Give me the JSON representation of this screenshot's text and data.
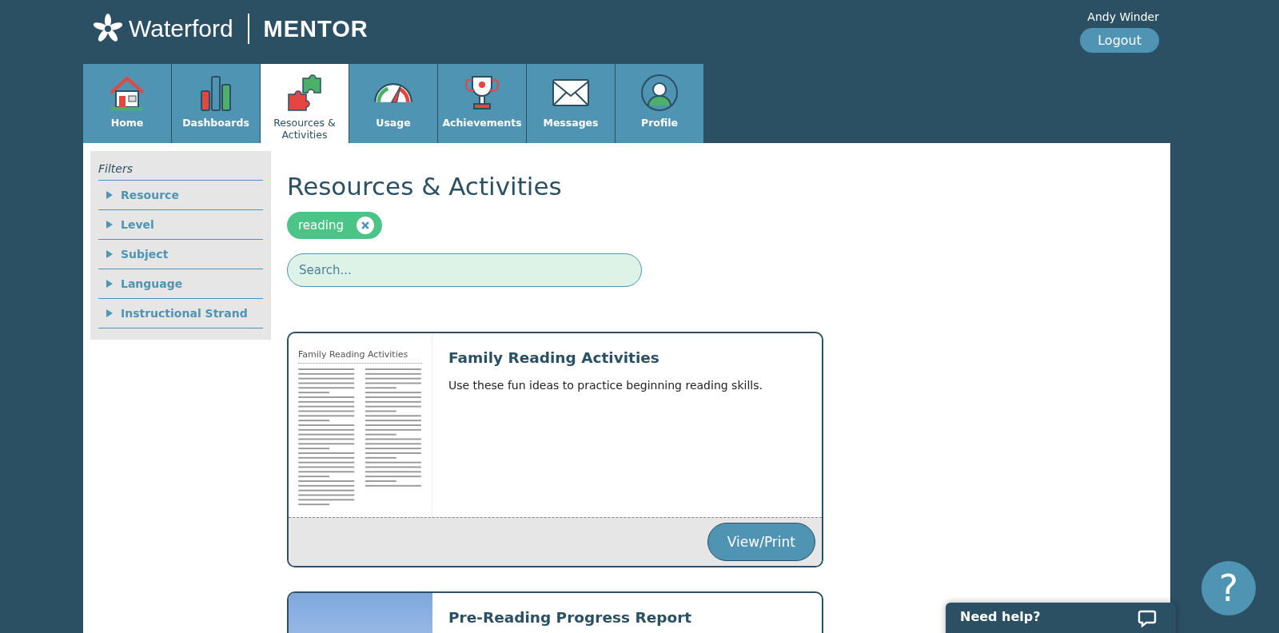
{
  "header": {
    "logo_text": "Waterford",
    "product": "MENTOR",
    "user": "Andy Winder",
    "logout": "Logout"
  },
  "tabs": [
    {
      "label": "Home",
      "kind": "home",
      "selected": false
    },
    {
      "label": "Dashboards",
      "kind": "bars",
      "selected": false
    },
    {
      "label": "Resources & Activities",
      "kind": "puzzle",
      "selected": true
    },
    {
      "label": "Usage",
      "kind": "gauge",
      "selected": false
    },
    {
      "label": "Achievements",
      "kind": "trophy",
      "selected": false
    },
    {
      "label": "Messages",
      "kind": "mail",
      "selected": false
    },
    {
      "label": "Profile",
      "kind": "person",
      "selected": false
    }
  ],
  "filters": {
    "title": "Filters",
    "items": [
      {
        "label": "Resource",
        "expanded": false
      },
      {
        "label": "Level",
        "expanded": false
      },
      {
        "label": "Subject",
        "expanded": false
      },
      {
        "label": "Language",
        "expanded": false
      },
      {
        "label": "Instructional Strand",
        "expanded": false
      }
    ]
  },
  "page_title": "Resources & Activities",
  "active_tags": [
    "reading"
  ],
  "search": {
    "placeholder": "Search..."
  },
  "cards": [
    {
      "kind": "document",
      "preview_title": "Family Reading Activities",
      "title": "Family Reading Activities",
      "description": "Use these fun ideas to practice beginning reading skills.",
      "button": "View/Print"
    },
    {
      "kind": "image",
      "title": "Pre-Reading Progress Report"
    }
  ],
  "help_chat": {
    "label": "Need help?"
  },
  "help_button": {
    "label": "?"
  }
}
